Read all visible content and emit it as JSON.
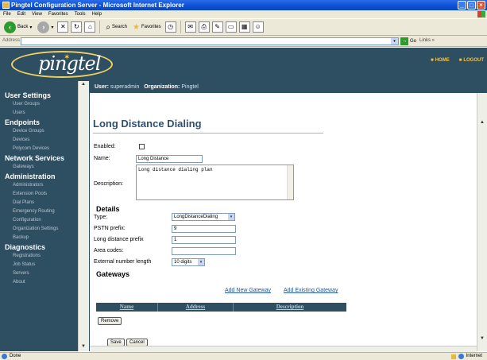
{
  "window": {
    "title": "Pingtel Configuration Server - Microsoft Internet Explorer"
  },
  "menu": [
    "File",
    "Edit",
    "View",
    "Favorites",
    "Tools",
    "Help"
  ],
  "toolbar": {
    "back": "Back",
    "search": "Search",
    "favorites": "Favorites"
  },
  "address": {
    "label": "Address",
    "go": "Go",
    "links": "Links »"
  },
  "brand": {
    "logo": "pingtel",
    "home": "HOME",
    "logout": "LOGOUT"
  },
  "user": {
    "user_label": "User:",
    "user_value": "superadmin",
    "org_label": "Organization:",
    "org_value": "Pingtel"
  },
  "sidebar": {
    "sections": [
      {
        "title": "User Settings",
        "items": [
          "User Groups",
          "Users"
        ]
      },
      {
        "title": "Endpoints",
        "items": [
          "Device Groups",
          "Devices",
          "Polycom Devices"
        ]
      },
      {
        "title": "Network Services",
        "items": [
          "Gateways"
        ]
      },
      {
        "title": "Administration",
        "items": [
          "Administrators",
          "Extension Pools",
          "Dial Plans",
          "Emergency Routing",
          "Configuration",
          "Organization Settings",
          "Backup"
        ]
      },
      {
        "title": "Diagnostics",
        "items": [
          "Registrations",
          "Job Status",
          "Servers",
          "About"
        ]
      }
    ]
  },
  "page": {
    "title": "Long Distance Dialing",
    "enabled_label": "Enabled:",
    "name_label": "Name:",
    "name_value": "Long Distance",
    "description_label": "Description:",
    "description_value": "Long distance dialing plan",
    "details_heading": "Details",
    "type_label": "Type:",
    "type_value": "LongDistanceDialing",
    "pstn_label": "PSTN prefix:",
    "pstn_value": "9",
    "ld_label": "Long distance prefix",
    "ld_value": "1",
    "area_label": "Area codes:",
    "area_value": "",
    "ext_label": "External number length",
    "ext_value": "10 digits",
    "gateways_heading": "Gateways",
    "add_new": "Add New Gateway",
    "add_existing": "Add Existing Gateway",
    "columns": [
      "Name",
      "Address",
      "Description"
    ],
    "remove": "Remove",
    "save": "Save",
    "cancel": "Cancel"
  },
  "status": {
    "left": "Done",
    "zone": "Internet"
  }
}
